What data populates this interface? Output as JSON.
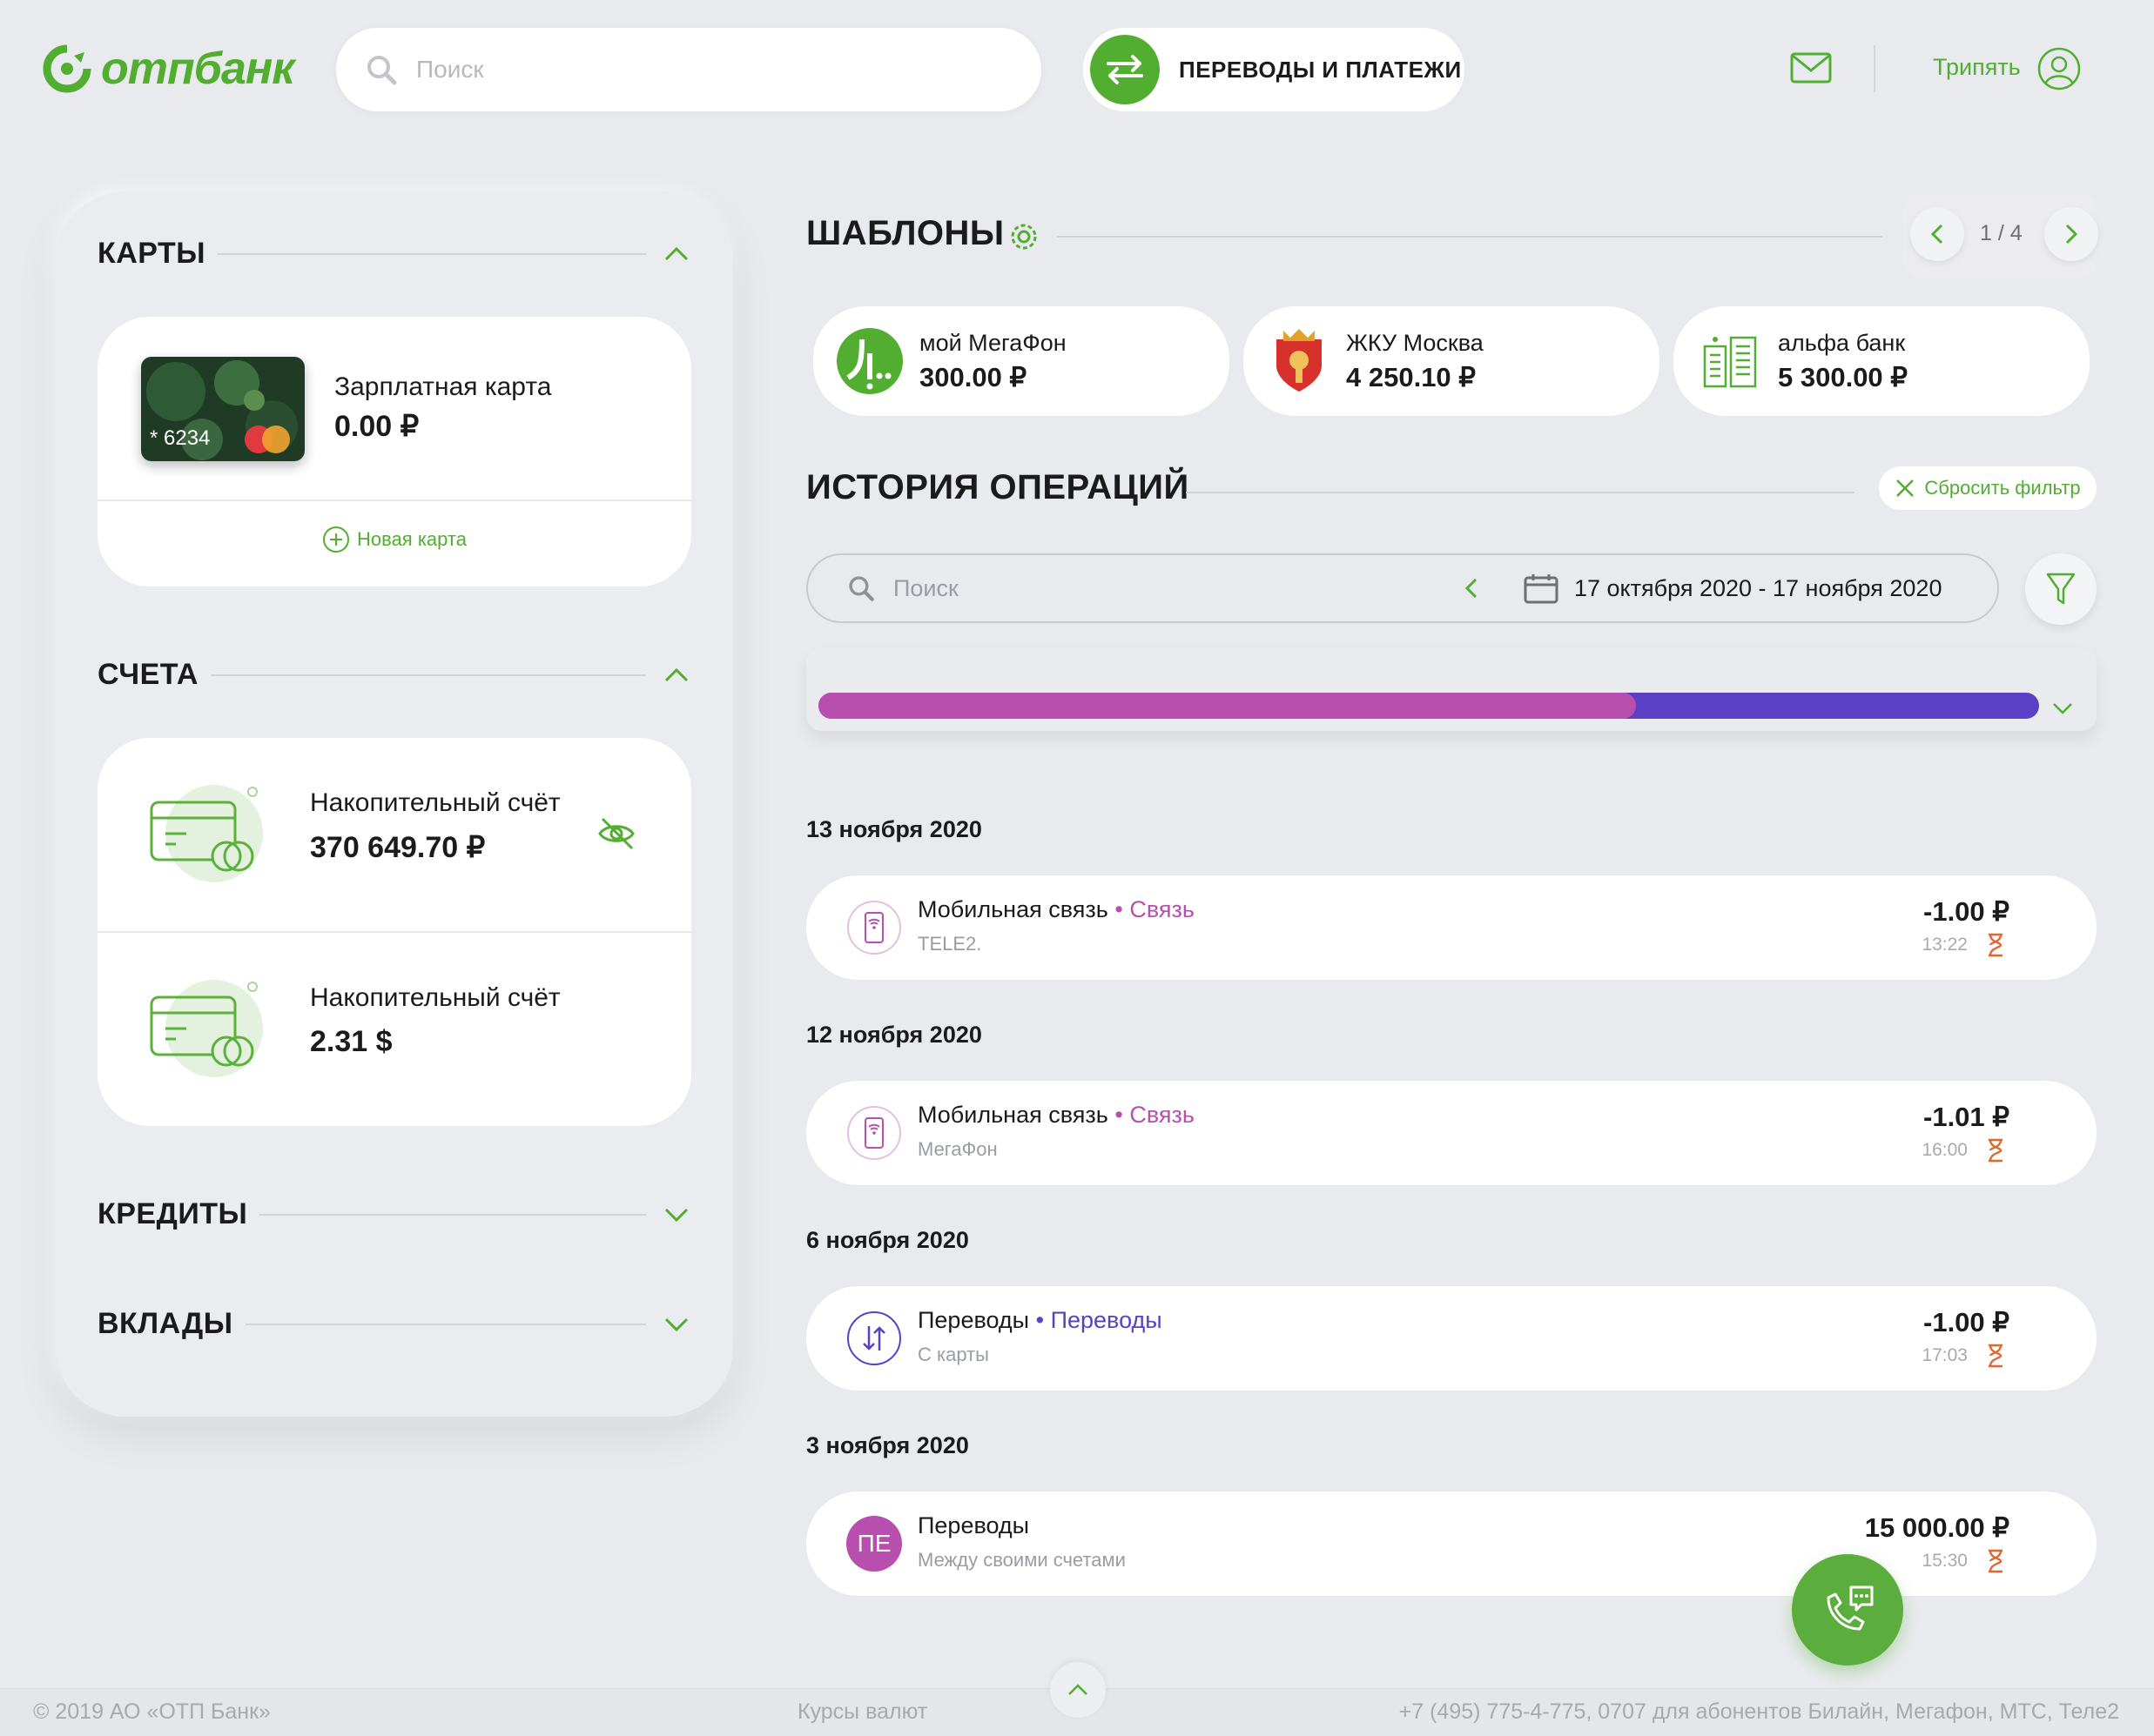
{
  "header": {
    "logo_text": "отпбанк",
    "search_placeholder": "Поиск",
    "transfers_label": "ПЕРЕВОДЫ И ПЛАТЕЖИ",
    "user_name": "Трипять"
  },
  "cards": {
    "title": "КАРТЫ",
    "card": {
      "name": "Зарплатная карта",
      "balance": "0.00 ₽",
      "number": "* 6234"
    },
    "new_card_label": "Новая карта"
  },
  "accounts": {
    "title": "СЧЕТА",
    "items": [
      {
        "name": "Накопительный счёт",
        "balance": "370 649.70 ₽"
      },
      {
        "name": "Накопительный счёт",
        "balance": "2.31 $"
      }
    ]
  },
  "credits": {
    "title": "КРЕДИТЫ"
  },
  "deposits": {
    "title": "ВКЛАДЫ"
  },
  "templates": {
    "title": "ШАБЛОНЫ",
    "page": "1 / 4",
    "items": [
      {
        "name": "мой МегаФон",
        "amount": "300.00 ₽"
      },
      {
        "name": "ЖКУ Москва",
        "amount": "4 250.10 ₽"
      },
      {
        "name": "альфа банк",
        "amount": "5 300.00 ₽"
      }
    ]
  },
  "history": {
    "title": "ИСТОРИЯ ОПЕРАЦИЙ",
    "reset_label": "Сбросить фильтр",
    "search_placeholder": "Поиск",
    "date_range": "17 октября 2020 - 17 ноября 2020",
    "bar_share": 0.67,
    "colors": {
      "primary": "#b84fae",
      "secondary": "#5a40c4"
    },
    "groups": [
      {
        "date": "13 ноября 2020",
        "ops": [
          {
            "title": "Мобильная связь",
            "category": "Связь",
            "sub": "TELE2.",
            "amount": "-1.00 ₽",
            "time": "13:22"
          }
        ]
      },
      {
        "date": "12 ноября 2020",
        "ops": [
          {
            "title": "Мобильная связь",
            "category": "Связь",
            "sub": "МегаФон",
            "amount": "-1.01 ₽",
            "time": "16:00"
          }
        ]
      },
      {
        "date": "6 ноября 2020",
        "ops": [
          {
            "title": "Переводы",
            "category": "Переводы",
            "sub": "С карты",
            "amount": "-1.00 ₽",
            "time": "17:03"
          }
        ]
      },
      {
        "date": "3 ноября 2020",
        "ops": [
          {
            "title": "Переводы",
            "category": "",
            "sub": "Между своими счетами",
            "amount": "15 000.00 ₽",
            "time": "15:30",
            "initials": "ПЕ"
          }
        ]
      }
    ]
  },
  "footer": {
    "copyright": "© 2019 АО «ОТП Банк»",
    "rates": "Курсы валют",
    "phone": "+7 (495) 775-4-775,  0707 для абонентов Билайн, Мегафон, МТС, Теле2"
  },
  "brand_color": "#52ae30"
}
